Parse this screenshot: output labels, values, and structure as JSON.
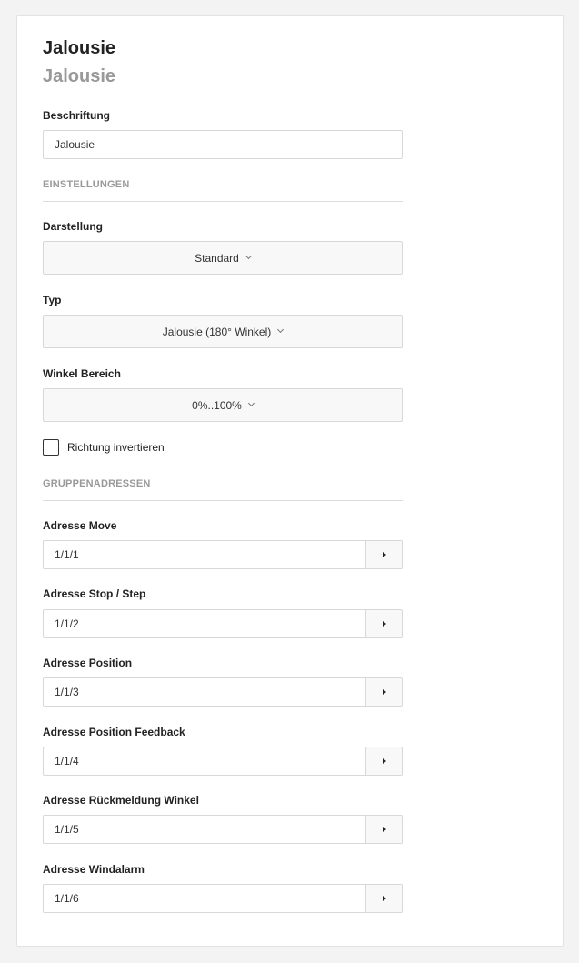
{
  "header": {
    "title": "Jalousie",
    "subtitle": "Jalousie"
  },
  "beschriftung": {
    "label": "Beschriftung",
    "value": "Jalousie"
  },
  "einstellungen": {
    "section_label": "EINSTELLUNGEN",
    "darstellung": {
      "label": "Darstellung",
      "value": "Standard"
    },
    "typ": {
      "label": "Typ",
      "value": "Jalousie (180° Winkel)"
    },
    "winkel": {
      "label": "Winkel Bereich",
      "value": "0%..100%"
    },
    "invert": {
      "label": "Richtung invertieren",
      "checked": false
    }
  },
  "gruppenadressen": {
    "section_label": "GRUPPENADRESSEN",
    "items": [
      {
        "label": "Adresse Move",
        "value": "1/1/1"
      },
      {
        "label": "Adresse Stop / Step",
        "value": "1/1/2"
      },
      {
        "label": "Adresse Position",
        "value": "1/1/3"
      },
      {
        "label": "Adresse Position Feedback",
        "value": "1/1/4"
      },
      {
        "label": "Adresse Rückmeldung Winkel",
        "value": "1/1/5"
      },
      {
        "label": "Adresse Windalarm",
        "value": "1/1/6"
      }
    ]
  },
  "icons": {
    "select_chevron": "chevron-down-icon",
    "address_button": "caret-right-icon"
  },
  "colors": {
    "background": "#f3f3f3",
    "card": "#ffffff",
    "muted_text": "#999999",
    "border": "#d8d8d8"
  }
}
